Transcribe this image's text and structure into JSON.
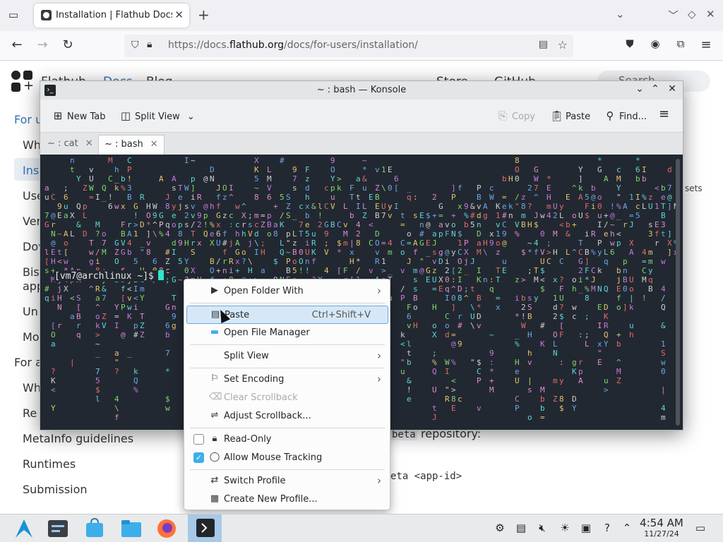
{
  "browser": {
    "tab_title": "Installation | Flathub Docs",
    "url_prefix": "https://docs.",
    "url_domain": "flathub.org",
    "url_path": "/docs/for-users/installation/"
  },
  "site": {
    "brand": "Flathub",
    "nav": [
      "Docs",
      "Blog",
      "Store",
      "GitHub"
    ],
    "search_placeholder": "Search",
    "sidebar_items": [
      "MetaInfo guidelines",
      "Runtimes",
      "Submission"
    ],
    "content_fragments": {
      "beta": "beta",
      "repository": "repository:",
      "command_tail": "eta <app-id>",
      "sets": "sets"
    },
    "partial_labels": [
      "For u",
      "Wh",
      "Ins",
      "Use",
      "Ver",
      "Dov",
      "Bis",
      "app",
      "Un",
      "Mo",
      "For a",
      "Wh",
      "Re"
    ]
  },
  "konsole": {
    "title": "~ : bash — Konsole",
    "toolbar": {
      "new_tab": "New Tab",
      "split_view": "Split View",
      "copy": "Copy",
      "paste": "Paste",
      "find": "Find..."
    },
    "tabs": [
      {
        "label": "~ : cat",
        "active": false
      },
      {
        "label": "~ : bash",
        "active": true
      }
    ],
    "prompt": "[vm7@archlinux ~]$"
  },
  "context_menu": {
    "items": [
      {
        "label": "Open Folder With",
        "icon": "folder-open-icon",
        "submenu": true
      },
      {
        "label": "Paste",
        "shortcut": "Ctrl+Shift+V",
        "icon": "paste-icon",
        "highlighted": true
      },
      {
        "label": "Open File Manager",
        "icon": "file-manager-icon"
      },
      {
        "label": "Split View",
        "submenu": true
      },
      {
        "label": "Set Encoding",
        "icon": "flag-icon",
        "submenu": true
      },
      {
        "label": "Clear Scrollback",
        "icon": "broom-icon",
        "disabled": true
      },
      {
        "label": "Adjust Scrollback...",
        "icon": "adjust-icon"
      },
      {
        "label": "Read-Only",
        "icon": "lock-icon",
        "checked": false
      },
      {
        "label": "Allow Mouse Tracking",
        "icon": "mouse-icon",
        "checked": true
      },
      {
        "label": "Switch Profile",
        "icon": "switch-profile-icon",
        "submenu": true
      },
      {
        "label": "Create New Profile...",
        "icon": "profile-icon"
      }
    ]
  },
  "taskbar": {
    "time": "4:54 AM",
    "date": "11/27/24"
  },
  "colors": {
    "terminal_bg": "#222831",
    "menu_highlight": "#d6e8f8",
    "accent": "#3daee9"
  }
}
